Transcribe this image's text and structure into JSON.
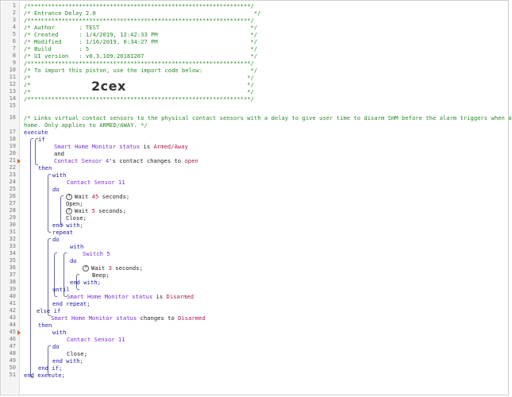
{
  "lines": [
    {
      "n": "1",
      "t": "/*****************************************************************/"
    },
    {
      "n": "2",
      "t": "/* Entrance Delay 2.0                                              */"
    },
    {
      "n": "3",
      "t": "/*****************************************************************/"
    },
    {
      "n": "4",
      "t": "/* Author       : TEST                                            */"
    },
    {
      "n": "5",
      "t": "/* Created      : 1/4/2019, 12:42:33 PM                           */"
    },
    {
      "n": "6",
      "t": "/* Modified     : 1/16/2019, 6:34:27 PM                           */"
    },
    {
      "n": "7",
      "t": "/* Build        : 5                                               */"
    },
    {
      "n": "8",
      "t": "/* UI version   : v0.3.109.20181207                               */"
    },
    {
      "n": "9",
      "t": "/*****************************************************************/"
    },
    {
      "n": "10",
      "t": "/* To import this piston, use the import code below:              */"
    },
    {
      "n": "11",
      "t": "/*                                                               */"
    },
    {
      "n": "12",
      "t": "/*                                                               */"
    },
    {
      "n": "13",
      "t": "/*                                                               */"
    },
    {
      "n": "14",
      "t": "/*****************************************************************/"
    },
    {
      "n": "15",
      "t": ""
    },
    {
      "n": "16",
      "t": "/* Links virtual contact sensors to the physical contact sensors with a delay to give user time to disarm SHM before the alarm triggers when arriving"
    },
    {
      "n": "",
      "t": "home. Only applies to ARMED/AWAY. */"
    }
  ],
  "import_code": "2cex",
  "code": {
    "execute": "execute",
    "if": "if",
    "cond1_dev": "Smart Home Monitor status",
    "cond1_op": " is ",
    "cond1_val": "Armed/Away",
    "and": "and",
    "cond2_dev": "Contact Sensor 4",
    "cond2_op": "'s contact changes to ",
    "cond2_val": "open",
    "then": "then",
    "with": "with",
    "sensor11": "Contact Sensor 11",
    "do": "do",
    "wait45_pre": "Wait ",
    "wait45_num": "45",
    "wait_suffix": " seconds;",
    "open": "Open;",
    "wait5_num": "5",
    "close": "Close;",
    "end_with": "end with;",
    "repeat": "repeat",
    "switch5": "Switch 5",
    "wait3_num": "3",
    "beep": "Beep;",
    "until": "until",
    "until_dev": "Smart Home Monitor status",
    "until_op": " is ",
    "until_val": "Disarmed",
    "end_repeat": "end repeat;",
    "else_if": "else if",
    "elif_dev": "Smart Home Monitor status",
    "elif_op": " changes to ",
    "elif_val": "Disarmed",
    "end_if": "end if;",
    "end_execute": "end execute;"
  },
  "line_numbers": [
    "17",
    "18",
    "19",
    "20",
    "21",
    "22",
    "23",
    "24",
    "25",
    "26",
    "27",
    "28",
    "29",
    "30",
    "31",
    "32",
    "33",
    "34",
    "35",
    "36",
    "37",
    "38",
    "39",
    "40",
    "41",
    "42",
    "43",
    "44",
    "45",
    "46",
    "47",
    "48",
    "49",
    "50",
    "51"
  ],
  "colors": {
    "comment": "#2a8a2a",
    "keyword": "#1a1aa6",
    "device": "#7b2bd0",
    "value": "#b0204a",
    "trigger": "#d2682a"
  }
}
